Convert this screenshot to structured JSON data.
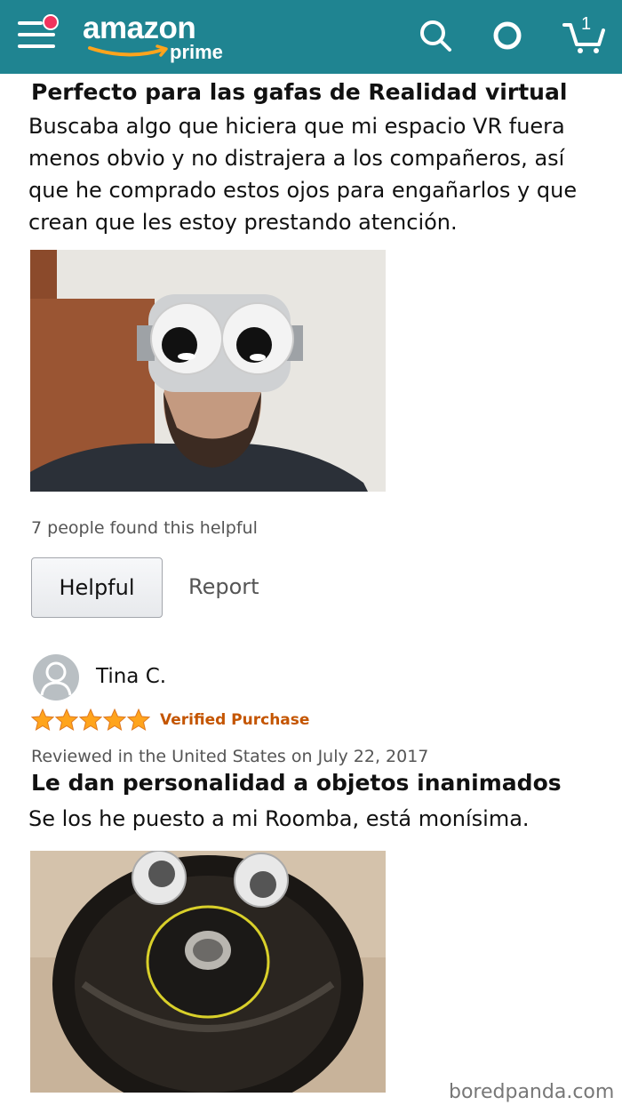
{
  "header": {
    "logo_word": "amazon",
    "logo_sub": "prime",
    "cart_count": "1",
    "icons": [
      "menu-icon",
      "search-icon",
      "alexa-icon",
      "cart-icon"
    ],
    "colors": {
      "bar": "#1f8491",
      "notification": "#f0335d"
    }
  },
  "review1": {
    "title": "Perfecto para las gafas de Realidad virtual",
    "body_lines": [
      "Buscaba algo que hiciera que mi espacio VR fuera",
      "menos obvio y no distrajera a los compañeros, así",
      "que he comprado estos ojos para engañarlos y que",
      "crean que les estoy prestando atención."
    ],
    "helpful_text": "7 people found this helpful",
    "helpful_button": "Helpful",
    "report_link": "Report"
  },
  "review2": {
    "reviewer": "Tina C.",
    "rating": 5,
    "verified": "Verified Purchase",
    "date": "Reviewed in the United States on July 22, 2017",
    "title": "Le dan personalidad a objetos inanimados",
    "body": "Se los he puesto a mi Roomba, está monísima."
  },
  "watermark": "boredpanda.com"
}
